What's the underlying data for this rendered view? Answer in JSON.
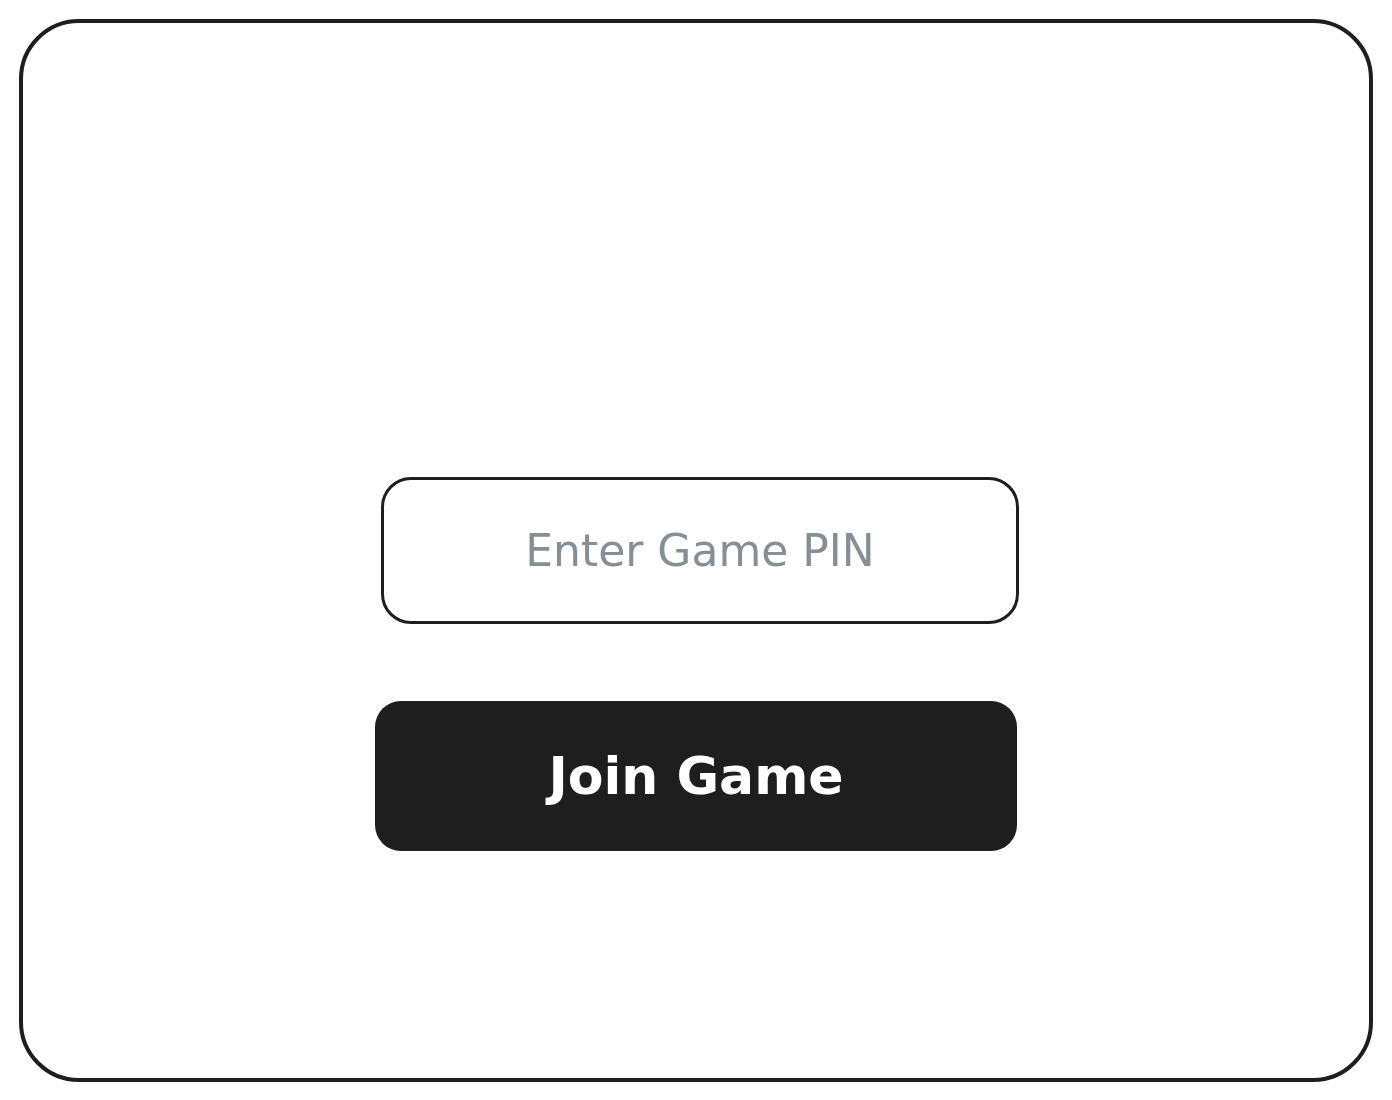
{
  "pin_field": {
    "placeholder": "Enter Game PIN"
  },
  "join_button": {
    "label": "Join Game"
  }
}
